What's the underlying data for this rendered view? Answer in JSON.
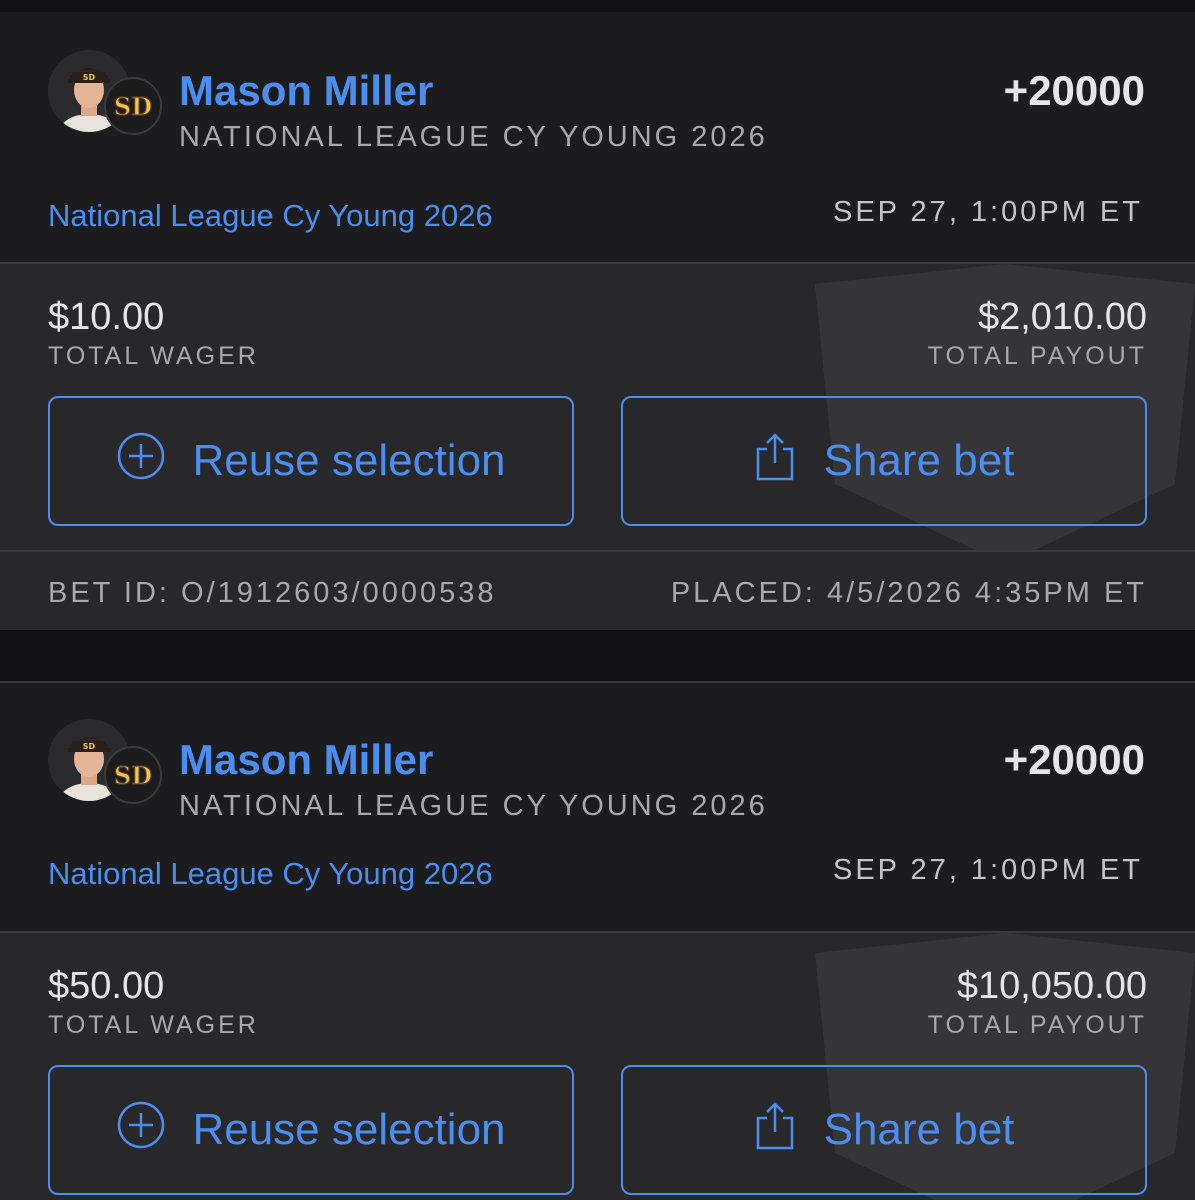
{
  "colors": {
    "accent": "#4a8ef0",
    "card_bg": "#1c1c1e",
    "panel_bg": "#28282b",
    "page_bg": "#111113"
  },
  "bets": [
    {
      "player_name": "Mason Miller",
      "market": "NATIONAL LEAGUE CY YOUNG 2026",
      "odds": "+20000",
      "event_name": "National League Cy Young 2026",
      "event_time": "SEP 27, 1:00PM ET",
      "team_badge_text": "SD",
      "total_wager": "$10.00",
      "total_wager_label": "TOTAL WAGER",
      "total_payout": "$2,010.00",
      "total_payout_label": "TOTAL PAYOUT",
      "reuse_label": "Reuse selection",
      "share_label": "Share bet",
      "bet_id": "BET ID: O/1912603/0000538",
      "placed": "PLACED: 4/5/2026 4:35PM ET"
    },
    {
      "player_name": "Mason Miller",
      "market": "NATIONAL LEAGUE CY YOUNG 2026",
      "odds": "+20000",
      "event_name": "National League Cy Young 2026",
      "event_time": "SEP 27, 1:00PM ET",
      "team_badge_text": "SD",
      "total_wager": "$50.00",
      "total_wager_label": "TOTAL WAGER",
      "total_payout": "$10,050.00",
      "total_payout_label": "TOTAL PAYOUT",
      "reuse_label": "Reuse selection",
      "share_label": "Share bet"
    }
  ],
  "icons": {
    "reuse": "plus-circle-icon",
    "share": "share-icon",
    "team": "padres-logo-icon",
    "watermark": "shield-watermark-icon"
  }
}
